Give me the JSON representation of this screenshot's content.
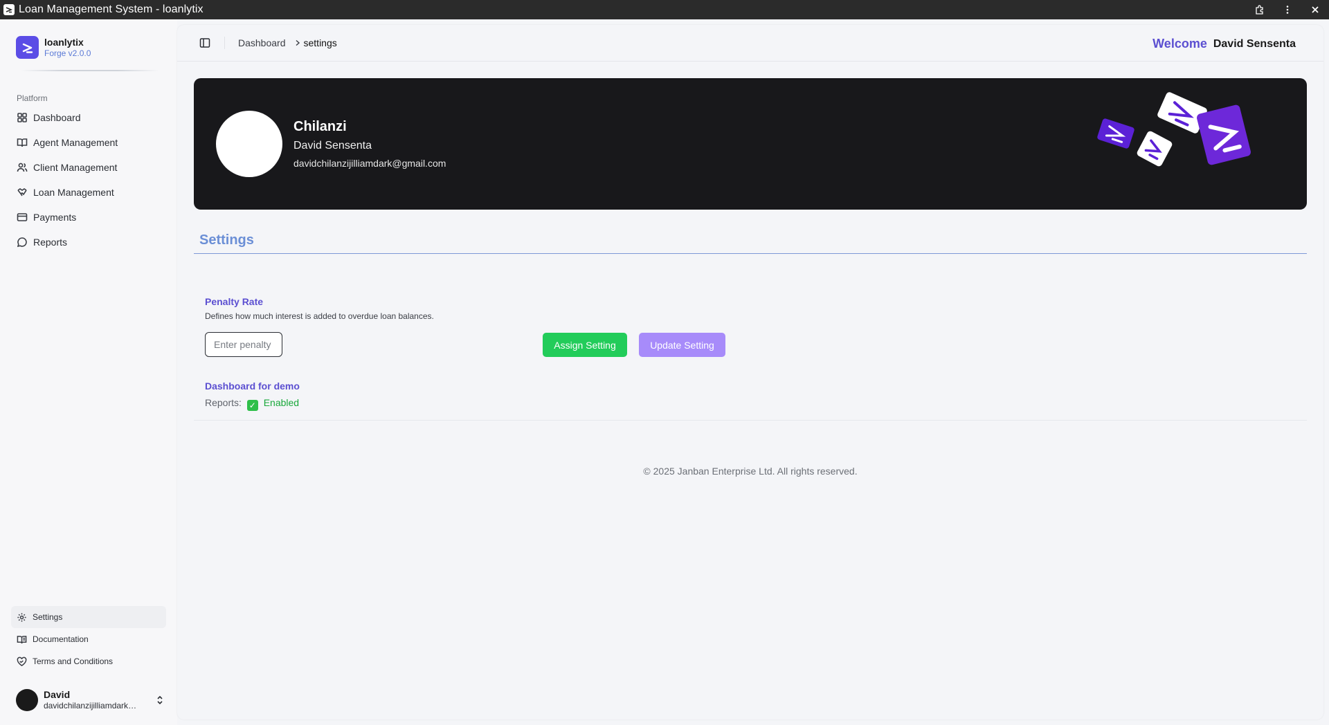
{
  "window": {
    "title": "Loan Management System - loanlytix",
    "controls": [
      "extension-icon",
      "more-icon",
      "close-icon"
    ]
  },
  "sidebar": {
    "brand_name": "loanlytix",
    "brand_version": "Forge v2.0.0",
    "section_label": "Platform",
    "items": [
      {
        "label": "Dashboard",
        "icon": "grid-icon"
      },
      {
        "label": "Agent Management",
        "icon": "book-open-icon"
      },
      {
        "label": "Client Management",
        "icon": "users-icon"
      },
      {
        "label": "Loan Management",
        "icon": "handshake-icon"
      },
      {
        "label": "Payments",
        "icon": "credit-card-icon"
      },
      {
        "label": "Reports",
        "icon": "message-icon"
      }
    ],
    "bottom_items": [
      {
        "label": "Settings",
        "icon": "gear-icon",
        "active": true
      },
      {
        "label": "Documentation",
        "icon": "book-icon"
      },
      {
        "label": "Terms and Conditions",
        "icon": "heart-handshake-icon"
      }
    ],
    "user": {
      "name": "David",
      "email": "davidchilanzijilliamdark@gmail.com"
    }
  },
  "header": {
    "breadcrumb_root": "Dashboard",
    "breadcrumb_current": "settings",
    "welcome_label": "Welcome",
    "welcome_name": "David Sensenta"
  },
  "profile": {
    "title": "Chilanzi",
    "name": "David Sensenta",
    "email": "davidchilanzijilliamdark@gmail.com"
  },
  "settings": {
    "heading": "Settings",
    "penalty": {
      "title": "Penalty Rate",
      "description": "Defines how much interest is added to overdue loan balances.",
      "placeholder": "Enter penalty rate",
      "value": "",
      "assign_label": "Assign Setting",
      "update_label": "Update Setting"
    },
    "demo": {
      "title": "Dashboard for demo",
      "label": "Reports:",
      "status": "Enabled"
    }
  },
  "footer": {
    "copyright": "© 2025 Janban Enterprise Ltd. All rights reserved."
  },
  "colors": {
    "brand": "#5b4de6",
    "accent_text": "#5b4fd1",
    "assign_button": "#22cc5a",
    "update_button": "#a78bfa",
    "banner_bg": "#18181b",
    "enabled_text": "#18a83a"
  }
}
